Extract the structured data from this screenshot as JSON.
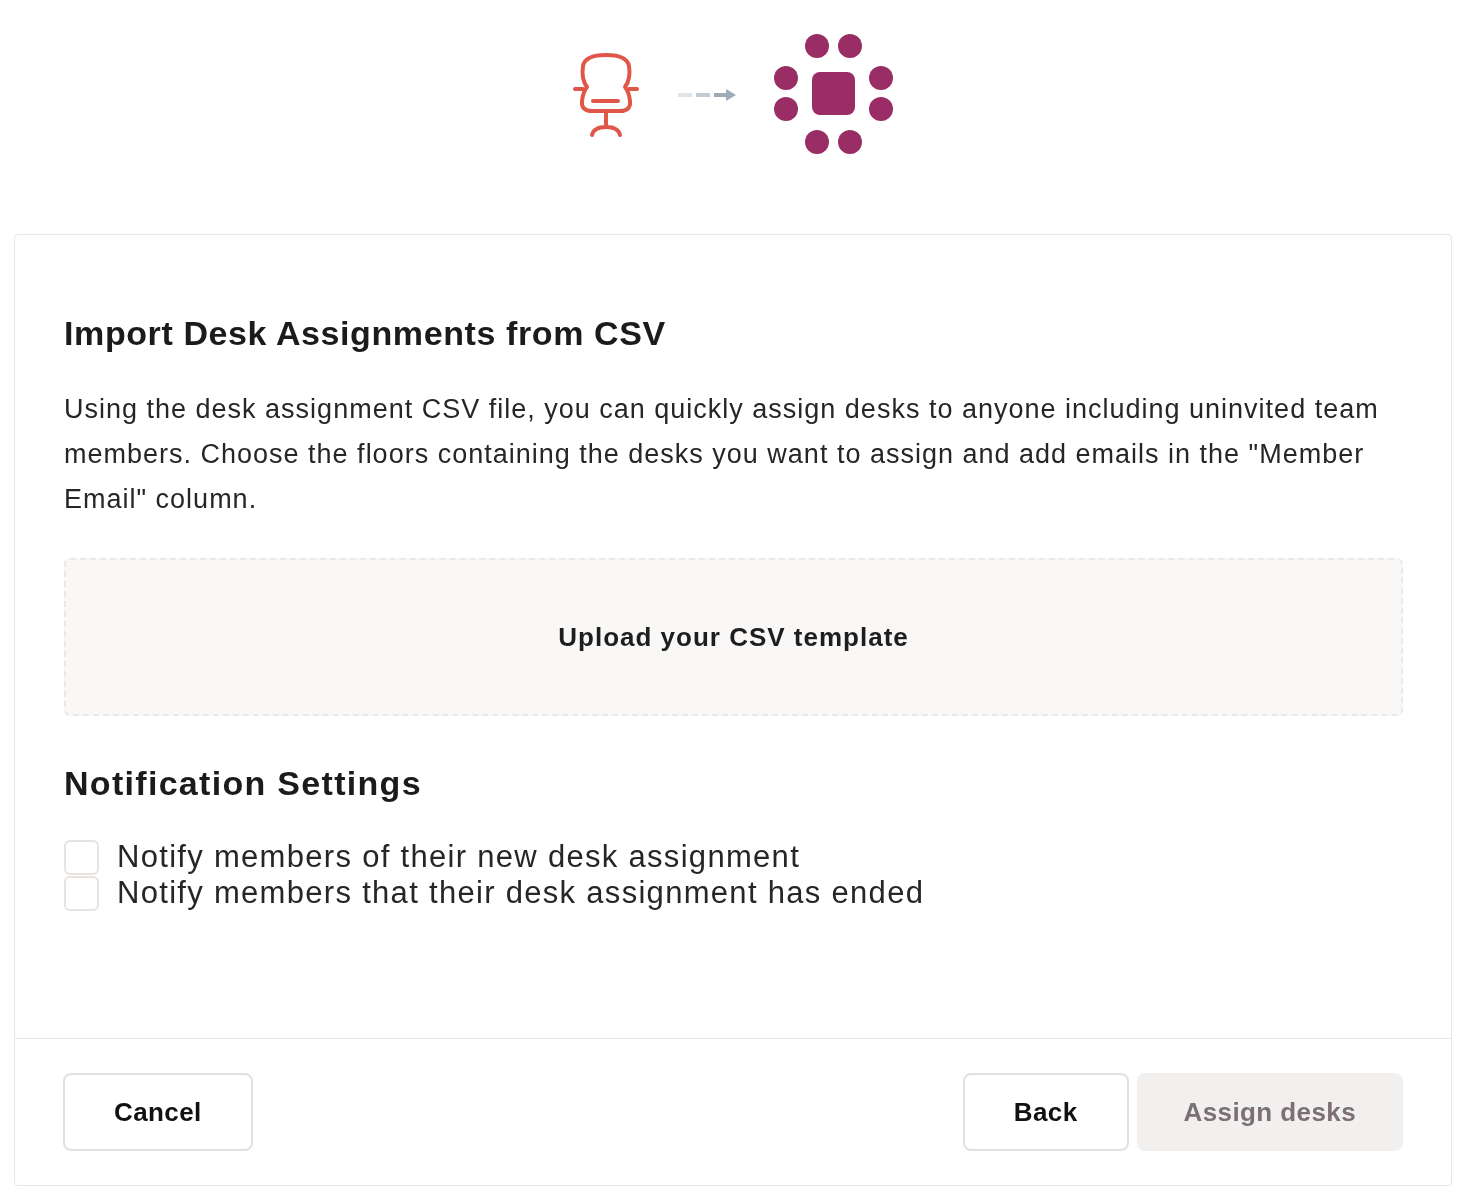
{
  "title": "Import Desk Assignments from CSV",
  "description": "Using the desk assignment CSV file, you can quickly assign desks to anyone including uninvited team members. Choose the floors containing the desks you want to assign and add emails in the \"Member Email\" column.",
  "upload": {
    "label": "Upload your CSV template"
  },
  "notifications": {
    "heading": "Notification Settings",
    "options": [
      {
        "label": "Notify members of their new desk assignment",
        "checked": false
      },
      {
        "label": "Notify members that their desk assignment has ended",
        "checked": false
      }
    ]
  },
  "footer": {
    "left_buttons": [
      {
        "label": "Cancel",
        "kind": "outline",
        "disabled": false
      }
    ],
    "right_buttons": [
      {
        "label": "Back",
        "kind": "outline",
        "disabled": false
      },
      {
        "label": "Assign desks",
        "kind": "filled",
        "disabled": true
      }
    ]
  }
}
